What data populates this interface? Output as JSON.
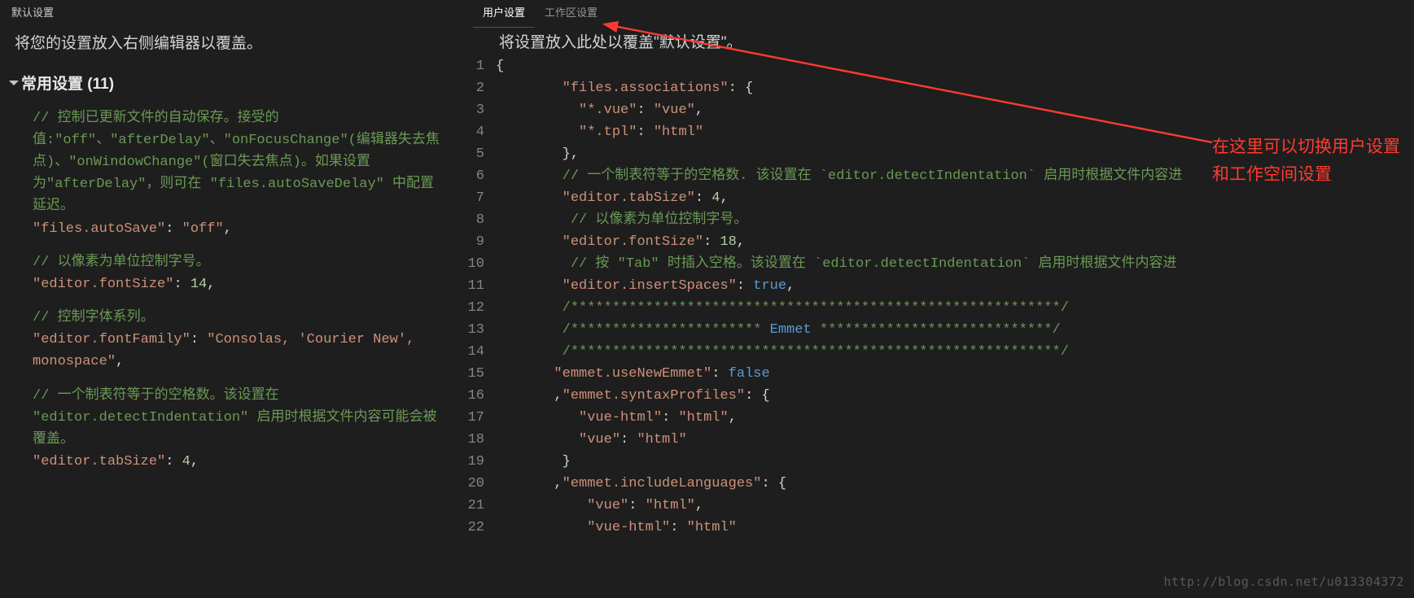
{
  "left": {
    "title": "默认设置",
    "hint": "将您的设置放入右侧编辑器以覆盖。",
    "section": "常用设置 (11)",
    "blocks": [
      {
        "comment": "// 控制已更新文件的自动保存。接受的值:\"off\"、\"afterDelay\"、\"onFocusChange\"(编辑器失去焦点)、\"onWindowChange\"(窗口失去焦点)。如果设置为\"afterDelay\"，则可在 \"files.autoSaveDelay\" 中配置延迟。",
        "setting_key": "\"files.autoSave\"",
        "setting_val": "\"off\"",
        "tail": ","
      },
      {
        "comment": "// 以像素为单位控制字号。",
        "setting_key": "\"editor.fontSize\"",
        "setting_val": "14",
        "tail": ","
      },
      {
        "comment": "// 控制字体系列。",
        "setting_key": "\"editor.fontFamily\"",
        "setting_val": "\"Consolas, 'Courier New', monospace\"",
        "tail": ","
      },
      {
        "comment": "// 一个制表符等于的空格数。该设置在 \"editor.detectIndentation\" 启用时根据文件内容可能会被覆盖。",
        "setting_key": "\"editor.tabSize\"",
        "setting_val": "4",
        "tail": ","
      }
    ]
  },
  "right": {
    "tabs": {
      "active": "用户设置",
      "inactive": "工作区设置"
    },
    "hint": "将设置放入此处以覆盖\"默认设置\"。",
    "lines": [
      "{",
      "        \"files.associations\": {",
      "          \"*.vue\": \"vue\",",
      "          \"*.tpl\": \"html\"",
      "        },",
      "        // 一个制表符等于的空格数. 该设置在 `editor.detectIndentation` 启用时根据文件内容进",
      "        \"editor.tabSize\": 4,",
      "         // 以像素为单位控制字号。",
      "        \"editor.fontSize\": 18,",
      "         // 按 \"Tab\" 时插入空格。该设置在 `editor.detectIndentation` 启用时根据文件内容进",
      "        \"editor.insertSpaces\": true,",
      "        /***********************************************************/",
      "        /*********************** Emmet ****************************/",
      "        /***********************************************************/",
      "       \"emmet.useNewEmmet\": false",
      "       ,\"emmet.syntaxProfiles\": {",
      "          \"vue-html\": \"html\",",
      "          \"vue\": \"html\"",
      "        }",
      "       ,\"emmet.includeLanguages\": {",
      "           \"vue\": \"html\",",
      "           \"vue-html\": \"html\""
    ]
  },
  "annotation": "在这里可以切换用户设置和工作空间设置",
  "watermark": "http://blog.csdn.net/u013304372"
}
